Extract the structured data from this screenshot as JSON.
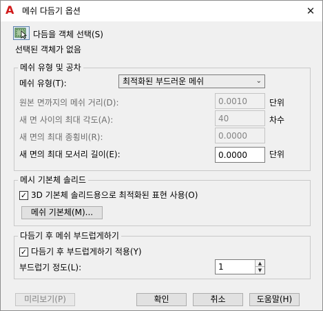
{
  "window": {
    "title": "메쉬 다듬기 옵션",
    "close_symbol": "✕",
    "app_icon": "A"
  },
  "select_objects": {
    "button_label": "다듬을 객체 선택(S)",
    "status": "선택된 객체가 없음"
  },
  "mesh_type_group": {
    "title": "메쉬 유형 및 공차",
    "mesh_type_label": "메쉬 유형(T):",
    "mesh_type_value": "최적화된 부드러운 메쉬",
    "distance_label": "원본 면까지의 메쉬 거리(D):",
    "distance_value": "0.0010",
    "distance_unit": "단위",
    "angle_label": "새 면 사이의 최대 각도(A):",
    "angle_value": "40",
    "angle_unit": "차수",
    "aspect_label": "새 면의 최대 종횡비(R):",
    "aspect_value": "0.0000",
    "edge_label": "새 면의 최대 모서리 길이(E):",
    "edge_value": "0.0000",
    "edge_unit": "단위"
  },
  "primitive_group": {
    "title": "메시 기본체 솔리드",
    "checkbox_label": "3D 기본체 솔리드용으로 최적화된 표현 사용(O)",
    "checkbox_checked": true,
    "button_label": "메쉬 기본체(M)..."
  },
  "smooth_group": {
    "title": "다듬기 후 메쉬 부드럽게하기",
    "checkbox_label": "다듬기 후 부드럽게하기 적용(Y)",
    "checkbox_checked": true,
    "level_label": "부드럽기 정도(L):",
    "level_value": "1"
  },
  "footer": {
    "preview": "미리보기(P)",
    "ok": "확인",
    "cancel": "취소",
    "help": "도움말(H)"
  },
  "colors": {
    "app_icon": "#d11a1a",
    "dialog_bg": "#f0f0f0"
  }
}
